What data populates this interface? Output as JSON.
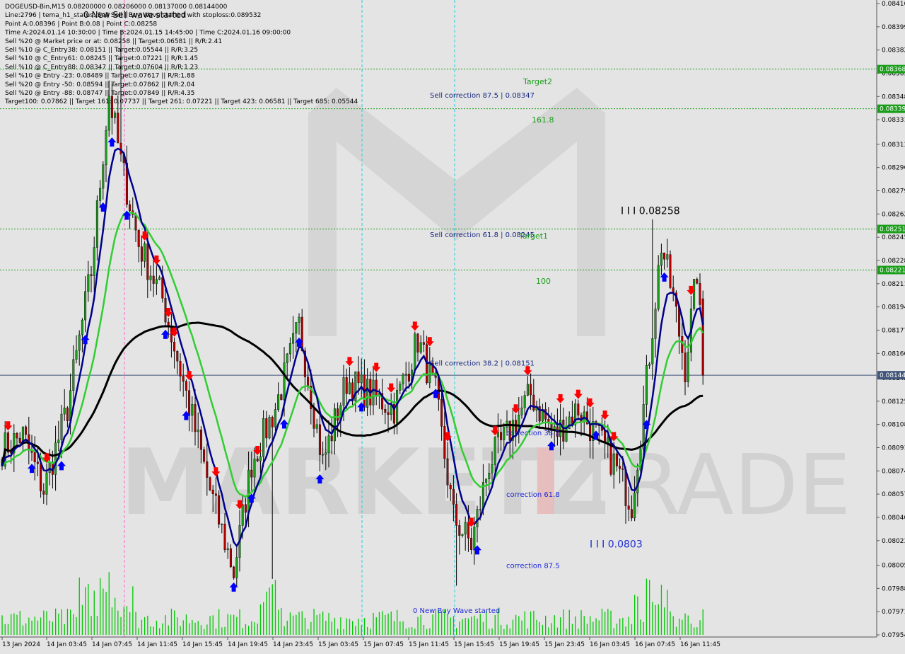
{
  "info": {
    "lines": [
      "DOGEUSD-Bin,M15  0.08200000 0.08206000 0.08137000 0.08144000",
      "Line:2796 | tema_h1_status: Sell Sell | Buy Wave started with stoploss:0.089532",
      "Point A:0.08396 | Point B:0.08 | Point C:0.08258",
      "Time A:2024.01.14 10:30:00 | Time B:2024.01.15 14:45:00 | Time C:2024.01.16 09:00:00",
      "Sell %20 @ Market price or at: 0.08258 || Target:0.06581 || R/R:2.41",
      "Sell %10 @ C_Entry38: 0.08151 || Target:0.05544 || R/R:3.25",
      "Sell %10 @ C_Entry61: 0.08245 || Target:0.07221 || R/R:1.45",
      "Sell %10 @ C_Entry88: 0.08347 || Target:0.07604 || R/R:1.23",
      "Sell %10 @ Entry -23: 0.08489 || Target:0.07617 || R/R:1.88",
      "Sell %20 @ Entry -50: 0.08594 || Target:0.07862 || R/R:2.04",
      "Sell %20 @ Entry -88: 0.08747 || Target:0.07849 || R/R:4.35",
      "Target100: 0.07862 || Target 161: 0.07737 || Target 261: 0.07221 || Target 423: 0.06581 || Target 685: 0.05544"
    ],
    "overlay_label": "0 New Sell wave started"
  },
  "chart_data": {
    "type": "candlestick",
    "symbol": "DOGEUSD-Bin",
    "timeframe": "M15",
    "ohlc_last": {
      "open": 0.082,
      "high": 0.08206,
      "low": 0.08137,
      "close": 0.08144
    },
    "ylim": [
      0.07954,
      0.08416
    ],
    "y_ticks": [
      "0.08416",
      "0.08399",
      "0.08382",
      "0.08365",
      "0.08348",
      "0.08331",
      "0.08313",
      "0.08296",
      "0.08279",
      "0.08262",
      "0.08245",
      "0.08228",
      "0.08211",
      "0.08194",
      "0.08177",
      "0.08160",
      "0.08142",
      "0.08125",
      "0.08108",
      "0.08091",
      "0.08074",
      "0.08057",
      "0.08040",
      "0.08023",
      "0.08005",
      "0.07988",
      "0.07971",
      "0.07954"
    ],
    "x_ticks": [
      "13 Jan 2024",
      "14 Jan 03:45",
      "14 Jan 07:45",
      "14 Jan 11:45",
      "14 Jan 15:45",
      "14 Jan 19:45",
      "14 Jan 23:45",
      "15 Jan 03:45",
      "15 Jan 07:45",
      "15 Jan 11:45",
      "15 Jan 15:45",
      "15 Jan 19:45",
      "15 Jan 23:45",
      "16 Jan 03:45",
      "16 Jan 07:45",
      "16 Jan 11:45"
    ],
    "horizontal_levels": [
      {
        "value": 0.08368,
        "name": "Target2",
        "box": "0.08368",
        "color": "#1a9e1a",
        "style": "dotted"
      },
      {
        "value": 0.08339,
        "name": "161.8",
        "box": "0.08339",
        "color": "#1a9e1a",
        "style": "dotted"
      },
      {
        "value": 0.08251,
        "name": "Target1",
        "box": "0.08251",
        "color": "#1a9e1a",
        "style": "dotted"
      },
      {
        "value": 0.08221,
        "name": "100",
        "box": "0.08221",
        "color": "#1a9e1a",
        "style": "dotted"
      },
      {
        "value": 0.08144,
        "name": "",
        "box": "0.08144",
        "color": "#40557a",
        "style": "solid"
      }
    ],
    "annotations": [
      {
        "text": "Sell correction 87.5 | 0.08347",
        "time": "15 Jan 11:45",
        "price": 0.08347,
        "color": "#1a2a80"
      },
      {
        "text": "Sell correction 61.8 | 0.08245",
        "time": "15 Jan 11:45",
        "price": 0.08245,
        "color": "#1a2a80"
      },
      {
        "text": "Sell correction 38.2 | 0.08151",
        "time": "15 Jan 11:45",
        "price": 0.08151,
        "color": "#1a2a80"
      },
      {
        "text": "I I I 0.08258",
        "time": "16 Jan 07:45",
        "price": 0.08262,
        "color": "#000000"
      },
      {
        "text": "I I I 0.0803",
        "time": "16 Jan 03:45",
        "price": 0.08018,
        "color": "#1f2ad6"
      },
      {
        "text": "correction 38.2",
        "time": "15 Jan 19:45",
        "price": 0.081,
        "color": "#1f2ad6"
      },
      {
        "text": "correction 61.8",
        "time": "15 Jan 19:45",
        "price": 0.08055,
        "color": "#1f2ad6"
      },
      {
        "text": "correction 87.5",
        "time": "15 Jan 19:45",
        "price": 0.08003,
        "color": "#1f2ad6"
      },
      {
        "text": "0 New Buy Wave started",
        "time": "15 Jan 11:45",
        "price": 0.0797,
        "color": "#1f2ad6"
      },
      {
        "text": "Target2",
        "time": "15 Jan 23:45",
        "price": 0.08357,
        "color": "#1a9e1a"
      },
      {
        "text": "161.8",
        "time": "15 Jan 23:45",
        "price": 0.08329,
        "color": "#1a9e1a"
      },
      {
        "text": "Target1",
        "time": "15 Jan 23:45",
        "price": 0.08244,
        "color": "#1a9e1a"
      },
      {
        "text": "100",
        "time": "15 Jan 23:45",
        "price": 0.08211,
        "color": "#1a9e1a"
      }
    ],
    "watermark": {
      "logo": "M",
      "text_left": "MARKETZ",
      "text_mid": "I",
      "text_right": "TRADE"
    },
    "colors": {
      "bull": "#1a9e1a",
      "bear": "#b00000",
      "ma_blue": "#00008b",
      "ma_green": "#32cd32",
      "ma_black": "#000000",
      "down_arrow": "#ff0000",
      "up_arrow": "#0000ff",
      "volume": "#00c800"
    },
    "anchors": [
      [
        0,
        0.0809
      ],
      [
        7,
        0.081
      ],
      [
        14,
        0.0806
      ],
      [
        22,
        0.0812
      ],
      [
        30,
        0.0822
      ],
      [
        36,
        0.0835
      ],
      [
        40,
        0.083
      ],
      [
        46,
        0.0824
      ],
      [
        54,
        0.082
      ],
      [
        62,
        0.0813
      ],
      [
        70,
        0.0806
      ],
      [
        78,
        0.08
      ],
      [
        84,
        0.0808
      ],
      [
        92,
        0.0812
      ],
      [
        100,
        0.0818
      ],
      [
        108,
        0.0808
      ],
      [
        116,
        0.0814
      ],
      [
        124,
        0.0813
      ],
      [
        132,
        0.0812
      ],
      [
        140,
        0.0817
      ],
      [
        146,
        0.0813
      ],
      [
        152,
        0.0804
      ],
      [
        158,
        0.0802
      ],
      [
        164,
        0.0808
      ],
      [
        170,
        0.081
      ],
      [
        178,
        0.0813
      ],
      [
        186,
        0.081
      ],
      [
        194,
        0.0812
      ],
      [
        200,
        0.081
      ],
      [
        206,
        0.0808
      ],
      [
        212,
        0.0805
      ],
      [
        216,
        0.0812
      ],
      [
        222,
        0.0824
      ],
      [
        226,
        0.082
      ],
      [
        230,
        0.0815
      ],
      [
        234,
        0.0822
      ],
      [
        236,
        0.0815
      ]
    ],
    "n_candles": 237
  }
}
